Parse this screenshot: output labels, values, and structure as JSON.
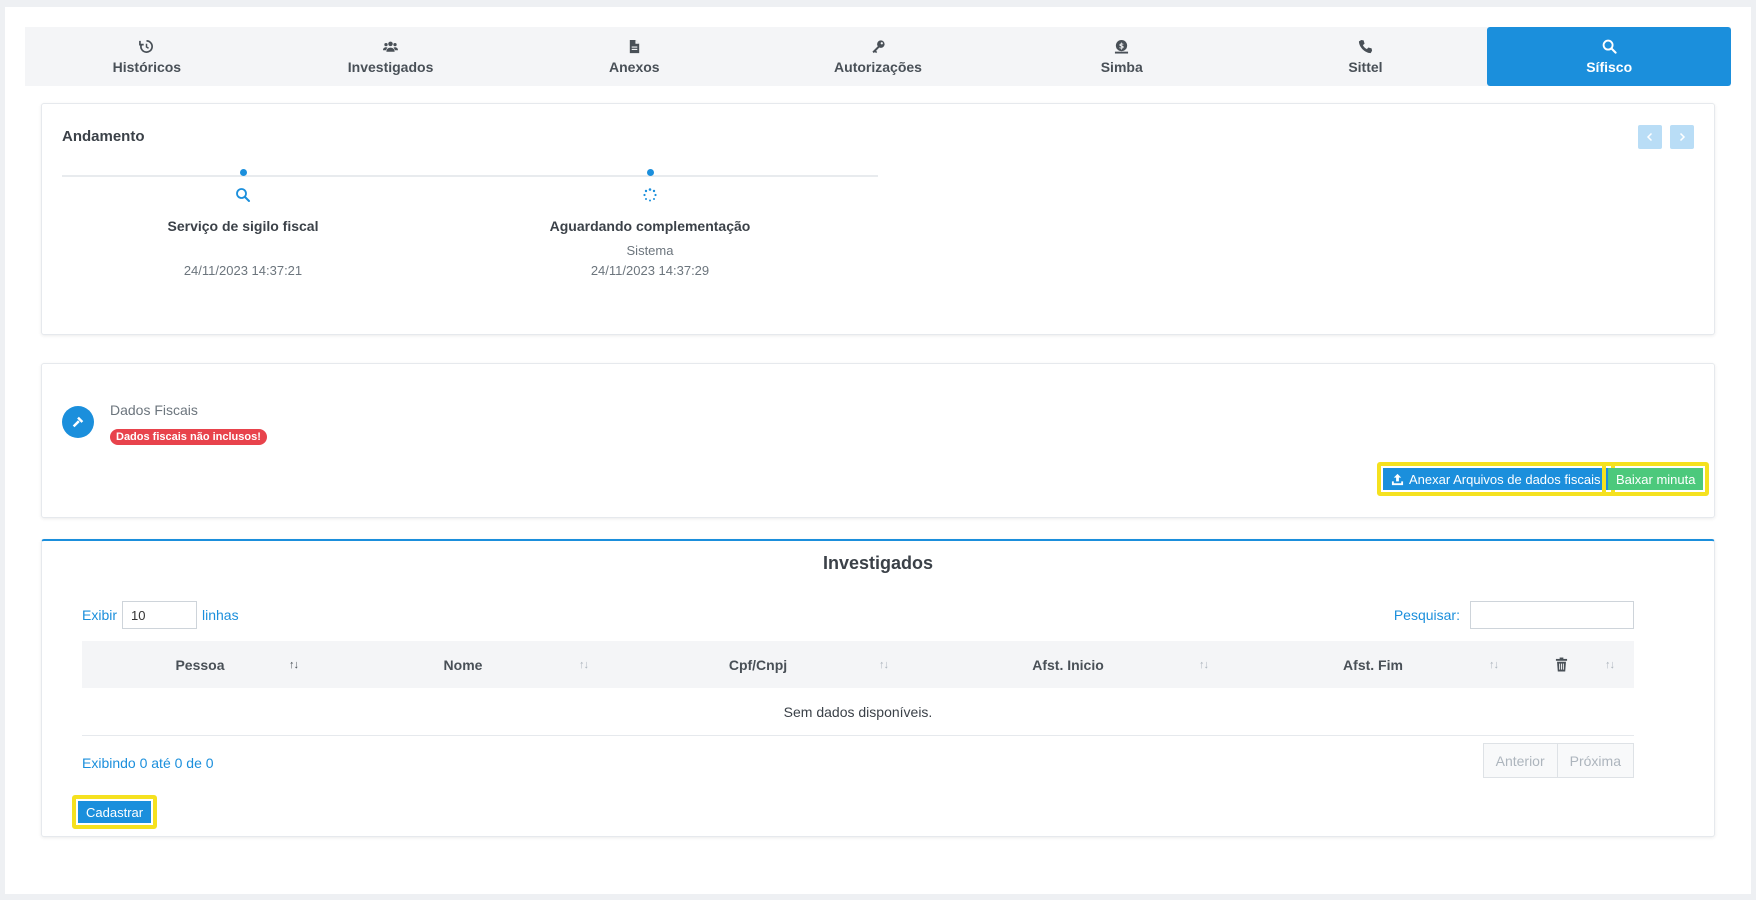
{
  "tabs": [
    {
      "label": "Históricos",
      "icon": "history-icon"
    },
    {
      "label": "Investigados",
      "icon": "users-icon"
    },
    {
      "label": "Anexos",
      "icon": "file-icon"
    },
    {
      "label": "Autorizações",
      "icon": "key-icon"
    },
    {
      "label": "Simba",
      "icon": "bank-icon"
    },
    {
      "label": "Sittel",
      "icon": "phone-icon"
    },
    {
      "label": "Sífisco",
      "icon": "search-icon",
      "active": true
    }
  ],
  "andamento": {
    "title": "Andamento",
    "steps": [
      {
        "title": "Serviço de sigilo fiscal",
        "sub": "",
        "date": "24/11/2023 14:37:21",
        "icon": "search-icon"
      },
      {
        "title": "Aguardando complementação",
        "sub": "Sistema",
        "date": "24/11/2023 14:37:29",
        "icon": "spinner-icon"
      }
    ]
  },
  "fiscais": {
    "label": "Dados Fiscais",
    "badge": "Dados fiscais não inclusos!",
    "attach_button": "Anexar Arquivos de dados fiscais",
    "download_button": "Baixar minuta"
  },
  "investigados": {
    "title": "Investigados",
    "show_label": "Exibir",
    "show_value": "10",
    "rows_label": "linhas",
    "search_label": "Pesquisar:",
    "columns": [
      "Pessoa",
      "Nome",
      "Cpf/Cnpj",
      "Afst. Inicio",
      "Afst. Fim"
    ],
    "empty_text": "Sem dados disponíveis.",
    "info": "Exibindo 0 até 0 de 0",
    "prev": "Anterior",
    "next": "Próxima",
    "register_button": "Cadastrar"
  },
  "colors": {
    "accent": "#1b8fdc",
    "danger": "#e8434c",
    "success": "#4cc97c",
    "highlight": "#f5e11f"
  }
}
